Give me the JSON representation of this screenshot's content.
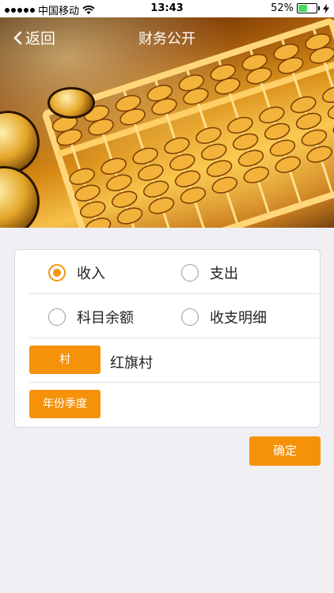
{
  "status_bar": {
    "carrier": "中国移动",
    "time": "13:43",
    "battery_percent": "52%",
    "battery_level": 0.52
  },
  "nav": {
    "back_label": "返回",
    "title": "财务公开"
  },
  "form": {
    "type_options": [
      {
        "label": "收入",
        "checked": true
      },
      {
        "label": "支出",
        "checked": false
      },
      {
        "label": "科目余额",
        "checked": false
      },
      {
        "label": "收支明细",
        "checked": false
      }
    ],
    "village_button": "村",
    "village_value": "红旗村",
    "period_button": "年份季度",
    "period_value": ""
  },
  "confirm_label": "确定",
  "colors": {
    "accent": "#f6920a",
    "background": "#efeff4"
  }
}
